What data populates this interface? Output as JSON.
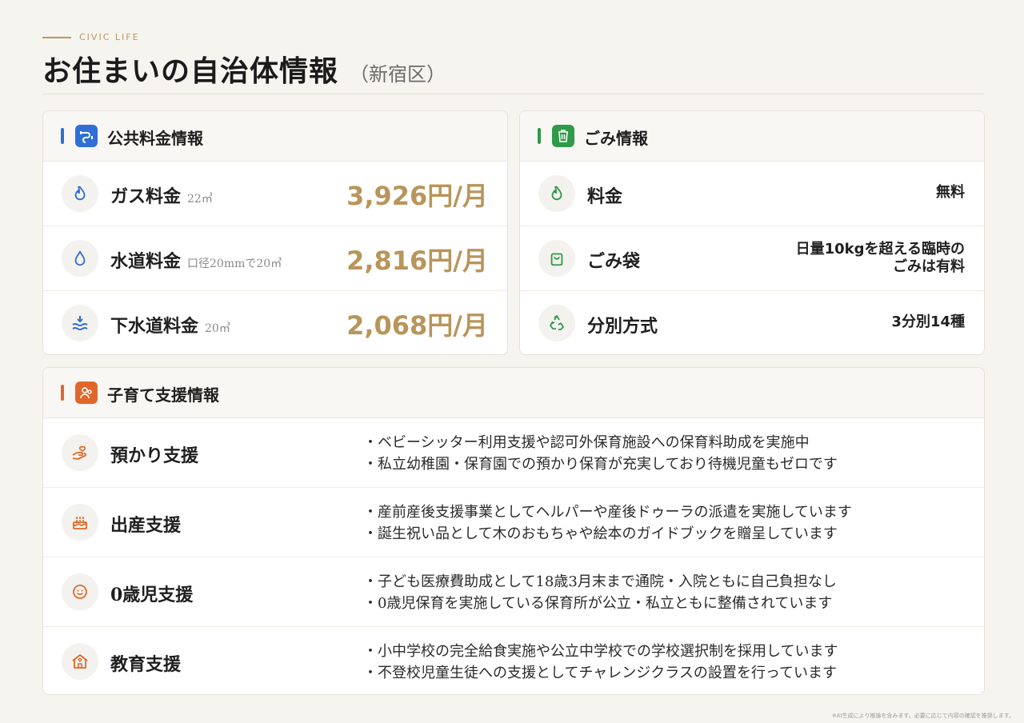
{
  "header": {
    "eyebrow": "CIVIC LIFE",
    "title": "お住まいの自治体情報",
    "subtitle": "（新宿区）"
  },
  "utilities": {
    "title": "公共料金情報",
    "accent": "#2f6fd6",
    "rows": [
      {
        "label": "ガス料金",
        "note": "22㎥",
        "value": "3,926円/月",
        "icon": "flame-icon"
      },
      {
        "label": "水道料金",
        "note": "口径20mmで20㎥",
        "value": "2,816円/月",
        "icon": "water-drop-icon"
      },
      {
        "label": "下水道料金",
        "note": "20㎥",
        "value": "2,068円/月",
        "icon": "sewage-icon"
      }
    ]
  },
  "garbage": {
    "title": "ごみ情報",
    "accent": "#2e9a4a",
    "rows": [
      {
        "label": "料金",
        "value": "無料",
        "icon": "flame-icon"
      },
      {
        "label": "ごみ袋",
        "value_line1": "日量10kgを超える臨時の",
        "value_line2": "ごみは有料",
        "icon": "bag-icon"
      },
      {
        "label": "分別方式",
        "value": "3分別14種",
        "icon": "recycle-icon"
      }
    ]
  },
  "childcare": {
    "title": "子育て支援情報",
    "accent": "#e0672a",
    "rows": [
      {
        "label": "預かり支援",
        "icon": "hand-heart-icon",
        "lines": [
          "ベビーシッター利用支援や認可外保育施設への保育料助成を実施中",
          "私立幼稚園・保育園での預かり保育が充実しており待機児童もゼロです"
        ]
      },
      {
        "label": "出産支援",
        "icon": "cake-icon",
        "lines": [
          "産前産後支援事業としてヘルパーや産後ドゥーラの派遣を実施しています",
          "誕生祝い品として木のおもちゃや絵本のガイドブックを贈呈しています"
        ]
      },
      {
        "label": "0歳児支援",
        "icon": "baby-icon",
        "lines": [
          "子ども医療費助成として18歳3月末まで通院・入院ともに自己負担なし",
          "0歳児保育を実施している保育所が公立・私立ともに整備されています"
        ]
      },
      {
        "label": "教育支援",
        "icon": "school-icon",
        "lines": [
          "小中学校の完全給食実施や公立中学校での学校選択制を採用しています",
          "不登校児童生徒への支援としてチャレンジクラスの設置を行っています"
        ]
      }
    ]
  },
  "footnote": "※AI生成により推論を含みます。必要に応じて内容の確認を推奨します。"
}
